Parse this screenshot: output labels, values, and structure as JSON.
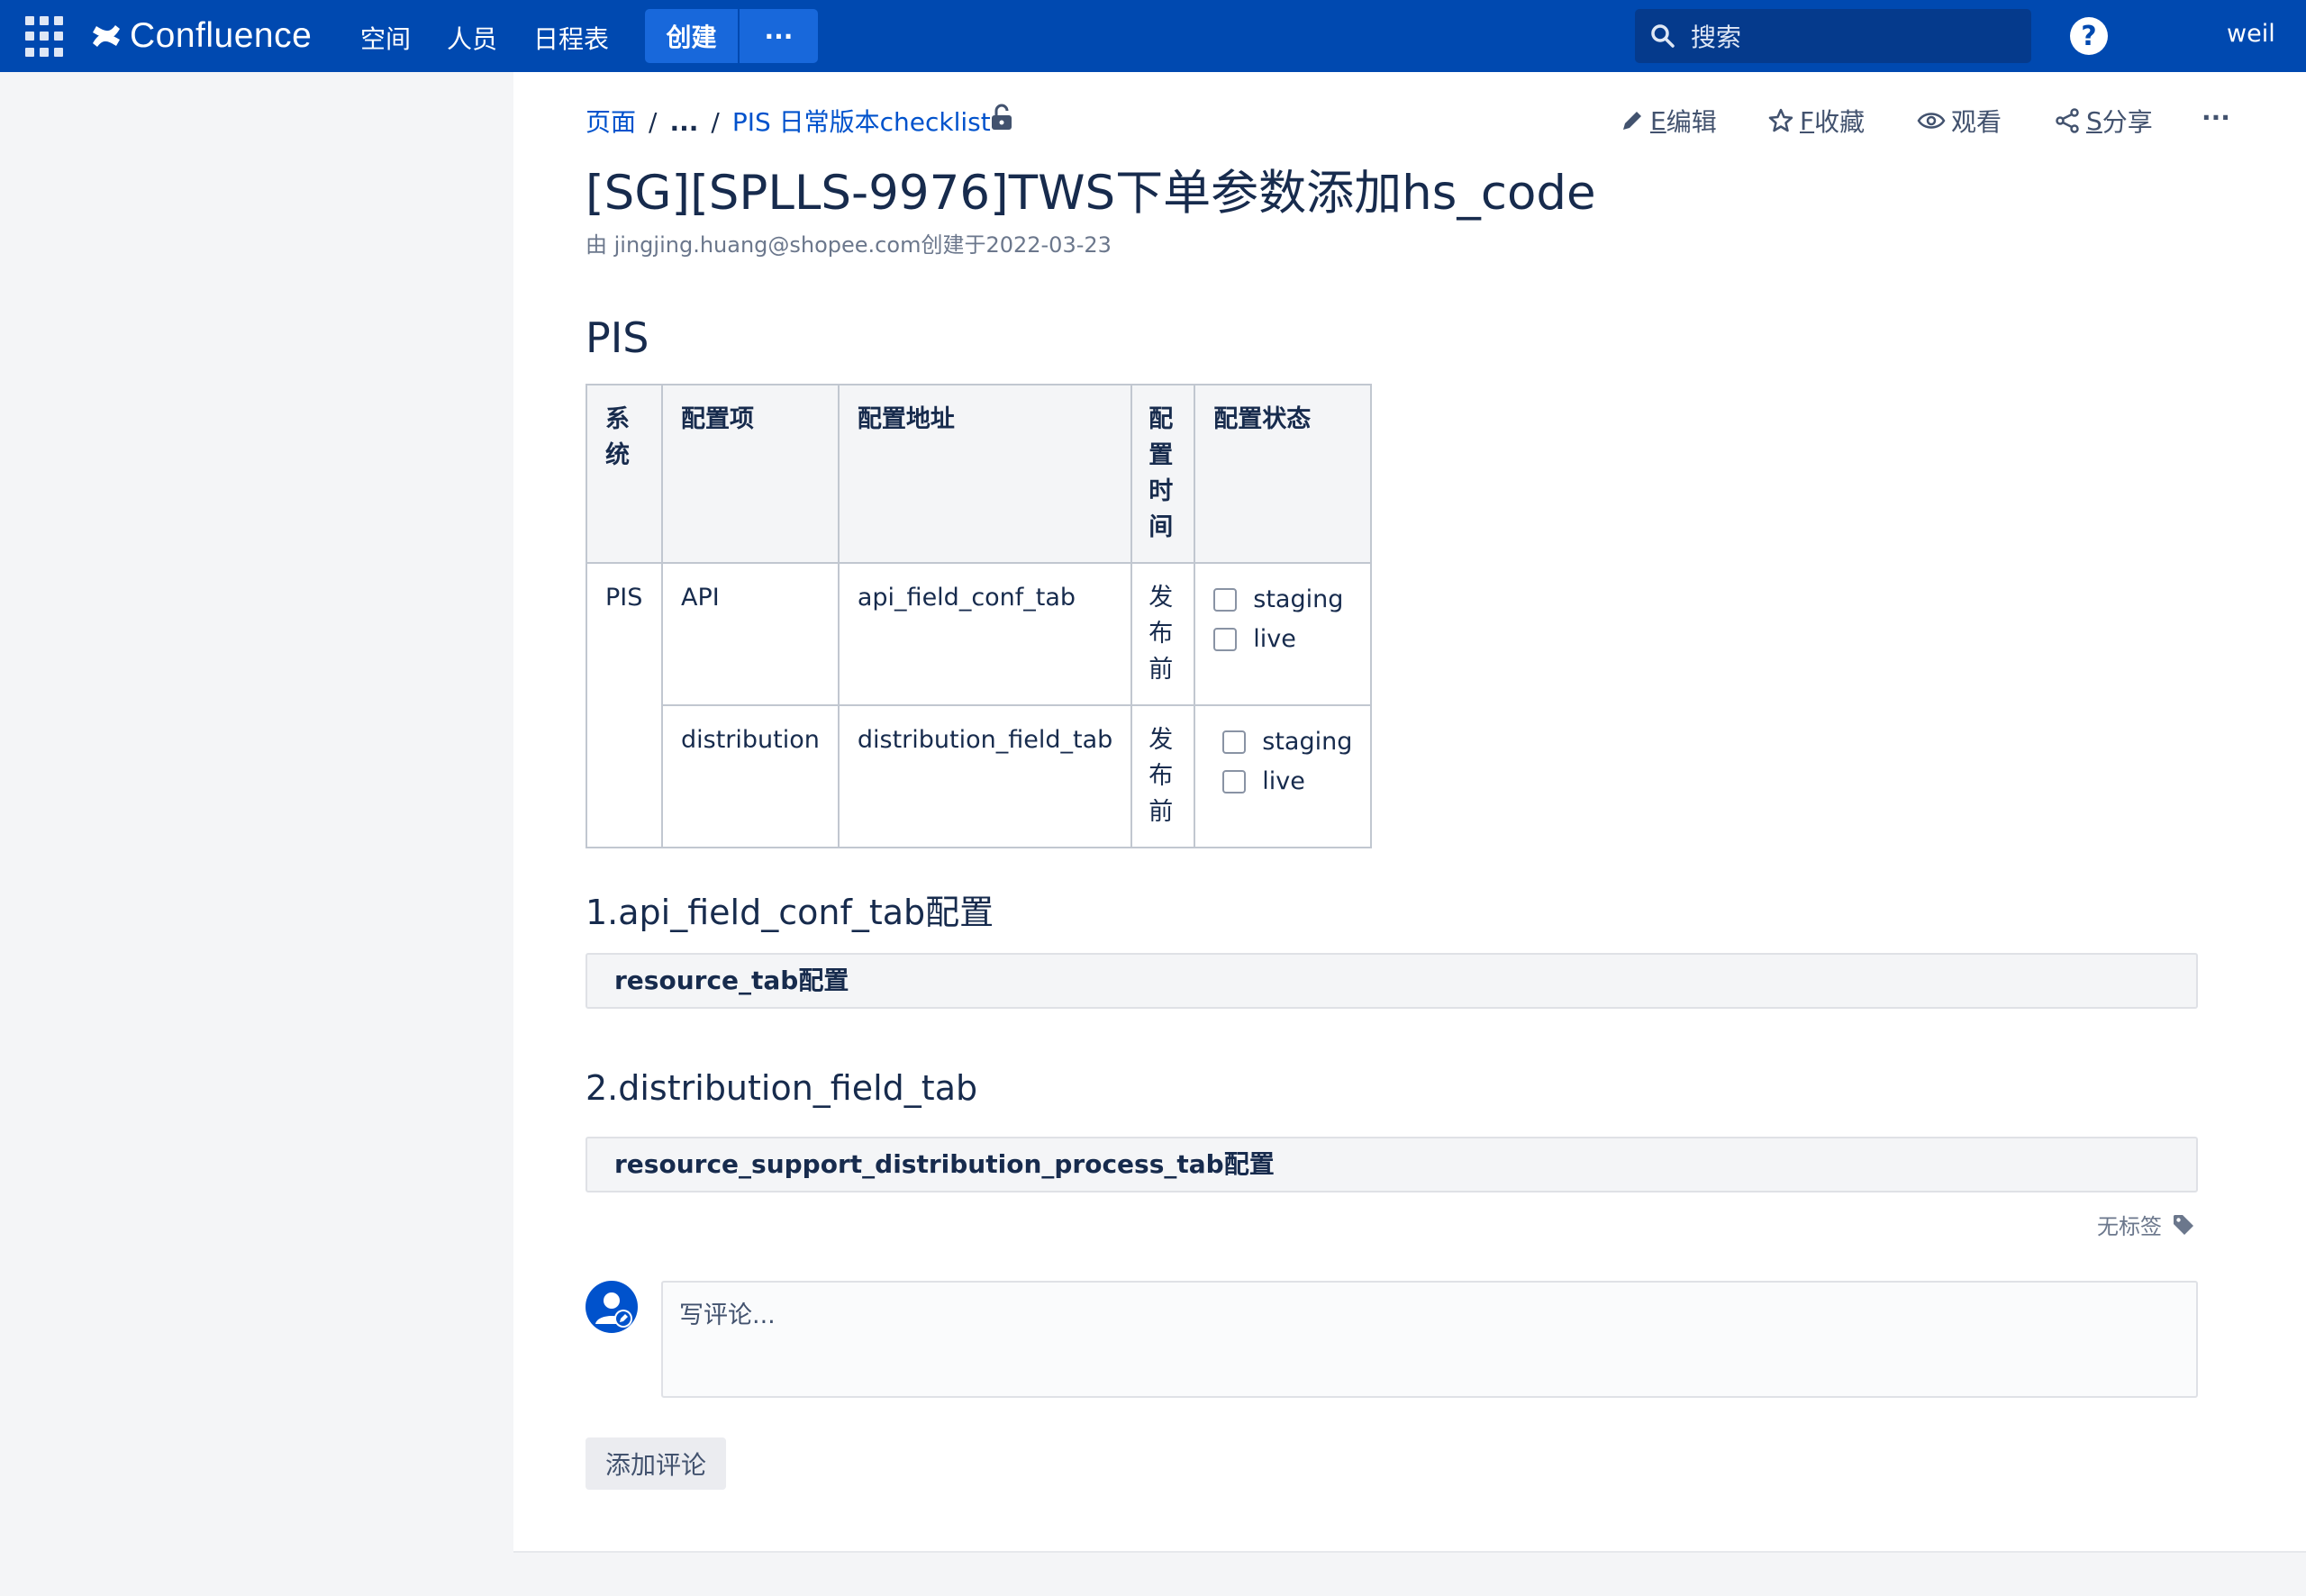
{
  "topnav": {
    "logo_text": "Confluence",
    "links": [
      "空间",
      "人员",
      "日程表"
    ],
    "create_label": "创建",
    "more_label": "···",
    "search_placeholder": "搜索",
    "help_label": "?",
    "user_name": "weil"
  },
  "breadcrumbs": {
    "root": "页面",
    "ellipsis": "...",
    "parent": "PIS 日常版本checklist"
  },
  "actions": {
    "edit_key": "E",
    "edit_label": "编辑",
    "fav_key": "F",
    "fav_label": "收藏",
    "watch_label": "观看",
    "share_key": "S",
    "share_label": "分享",
    "more_label": "···"
  },
  "page": {
    "title": "[SG][SPLLS-9976]TWS下单参数添加hs_code",
    "byline": "由 jingjing.huang@shopee.com创建于2022-03-23",
    "section_heading": "PIS"
  },
  "table": {
    "headers": [
      "系统",
      "配置项",
      "配置地址",
      "配置时间",
      "配置状态"
    ],
    "system": "PIS",
    "rows": [
      {
        "item": "API",
        "address": "api_field_conf_tab",
        "time": "发布前",
        "status": [
          "staging",
          "live"
        ]
      },
      {
        "item": "distribution",
        "address": "distribution_field_tab",
        "time": "发布前",
        "status": [
          "staging",
          "live"
        ]
      }
    ]
  },
  "sections": [
    {
      "heading": "1.api_field_conf_tab配置",
      "code": "resource_tab配置"
    },
    {
      "heading": "2.distribution_field_tab",
      "code": "resource_support_distribution_process_tab配置"
    }
  ],
  "labels_text": "无标签",
  "comment": {
    "placeholder": "写评论...",
    "button": "添加评论"
  },
  "colors": {
    "nav": "#0049b0",
    "create": "#1868db",
    "link": "#0052cc"
  }
}
